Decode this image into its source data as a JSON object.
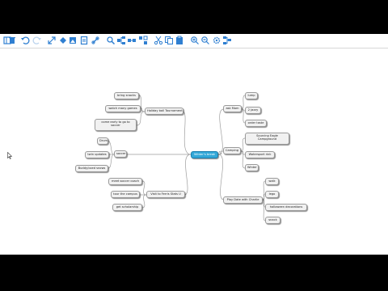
{
  "toolbar": {
    "icons": [
      "panel-icon",
      "trash-icon",
      "undo-icon",
      "redo-icon",
      "expand-icon",
      "fill-icon",
      "image-icon",
      "note-icon",
      "link-icon",
      "search-icon",
      "add-child-icon",
      "add-sibling-icon",
      "share-icon",
      "cut-icon",
      "copy-icon",
      "paste-icon",
      "zoom-in-icon",
      "zoom-out-icon",
      "settings-icon",
      "layout-icon"
    ],
    "accent": "#2f7fd1"
  },
  "mindmap": {
    "central": "Winter's break",
    "branches": {
      "holiday": {
        "label": "Holiday ball Tournament",
        "children": [
          "bring snacks",
          "watch many games",
          "come early to go to soccer"
        ]
      },
      "soccer": {
        "label": "soccer",
        "children": [
          "Drum",
          "twin updates",
          "Buddy/coed snows"
        ]
      },
      "friends": {
        "label": "Visit to Ferris Stats U",
        "children": [
          "meet soccer coach",
          "tour the campus",
          "get scholarship"
        ]
      },
      "ski": {
        "label": "ask Mom",
        "children": [
          "lump",
          "2 jazzy",
          "order taste"
        ]
      },
      "camping": {
        "label": "Camping",
        "children": [
          "Sourcing Eagle Campground",
          "Watersport rink",
          "Winter"
        ]
      },
      "play": {
        "label": "Play Date with Charlie",
        "children": [
          "walk",
          "lego",
          "halloween decorations",
          "snack"
        ]
      }
    },
    "colors": {
      "central": "#34a8d8",
      "link": "#9d9d9d"
    }
  }
}
